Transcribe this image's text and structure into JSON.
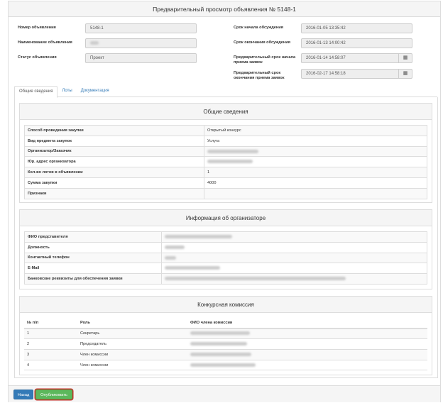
{
  "title": "Предварительный просмотр объявления № 5148-1",
  "header": {
    "left": [
      {
        "label": "Номер объявления",
        "value": "5148-1"
      },
      {
        "label": "Наименование объявления",
        "value": ""
      },
      {
        "label": "Статус объявления",
        "value": "Проект"
      }
    ],
    "right": [
      {
        "label": "Срок начала обсуждения",
        "value": "2016-01-05 13:35:42"
      },
      {
        "label": "Срок окончания обсуждения",
        "value": "2016-01-13 14:00:42"
      },
      {
        "label": "Предварительный срок начала приема заявок",
        "value": "2016-01-14 14:58:07"
      },
      {
        "label": "Предварительный срок окончания приема заявок",
        "value": "2016-02-17 14:58:18"
      }
    ],
    "calendar_icon": "calendar-icon"
  },
  "tabs": [
    "Общие сведения",
    "Лоты",
    "Документация"
  ],
  "general": {
    "heading": "Общие сведения",
    "rows": [
      {
        "label": "Способ проведения закупки",
        "value": "Открытый конкурс"
      },
      {
        "label": "Вид предмета закупок",
        "value": "Услуга"
      },
      {
        "label": "Организатор/Заказчик",
        "value": ""
      },
      {
        "label": "Юр. адрес организатора",
        "value": ""
      },
      {
        "label": "Кол-во лотов в объявлении",
        "value": "1"
      },
      {
        "label": "Сумма закупки",
        "value": "4000"
      },
      {
        "label": "Признаки",
        "value": ""
      }
    ]
  },
  "organizer": {
    "heading": "Информация об организаторе",
    "rows": [
      {
        "label": "ФИО представителя",
        "value": ""
      },
      {
        "label": "Должность",
        "value": ""
      },
      {
        "label": "Контактный телефон",
        "value": ""
      },
      {
        "label": "E-Mail",
        "value": ""
      },
      {
        "label": "Банковские реквизиты для обеспечения заявки",
        "value": ""
      }
    ]
  },
  "commission": {
    "heading": "Конкурсная комиссия",
    "columns": [
      "№ п/п",
      "Роль",
      "ФИО члена комиссии"
    ],
    "rows": [
      {
        "num": "1",
        "role": "Секретарь",
        "name": ""
      },
      {
        "num": "2",
        "role": "Председатель",
        "name": ""
      },
      {
        "num": "3",
        "role": "Член комиссии",
        "name": ""
      },
      {
        "num": "4",
        "role": "Член комиссии",
        "name": ""
      }
    ]
  },
  "buttons": {
    "back": "Назад",
    "publish": "Опубликовать"
  },
  "colors": {
    "primary": "#337ab7",
    "success": "#5cb85c",
    "highlight": "#c9302c"
  }
}
